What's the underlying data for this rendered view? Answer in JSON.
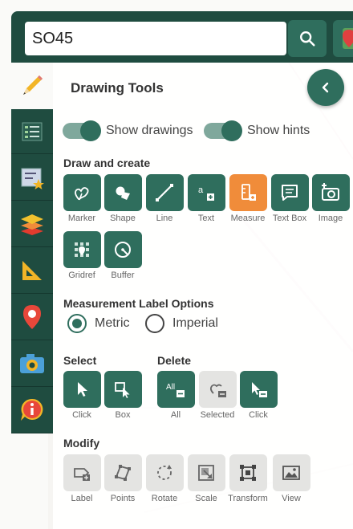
{
  "search": {
    "value": "SO45"
  },
  "icons": {
    "search": "search-icon",
    "map": "map-pin-icon",
    "pencil": "pencil-icon",
    "legend": "legend-list-icon",
    "bookmark": "star-bookmark-icon",
    "layers": "layers-icon",
    "ruler": "set-square-icon",
    "location": "location-pin-icon",
    "camera": "camera-icon",
    "info": "info-icon",
    "collapse": "chevron-left-icon"
  },
  "panel": {
    "title": "Drawing Tools",
    "toggles": [
      {
        "label": "Show drawings",
        "on": true
      },
      {
        "label": "Show hints",
        "on": true
      }
    ],
    "draw_section": "Draw and create",
    "draw_tools": [
      "Marker",
      "Shape",
      "Line",
      "Text",
      "Measure",
      "Text Box",
      "Image"
    ],
    "draw_tools_row2": [
      "Gridref",
      "Buffer"
    ],
    "measure_section": "Measurement Label Options",
    "measure_options": [
      {
        "label": "Metric",
        "selected": true
      },
      {
        "label": "Imperial",
        "selected": false
      }
    ],
    "select_section": "Select",
    "select_tools": [
      "Click",
      "Box"
    ],
    "delete_section": "Delete",
    "delete_tools": [
      "All",
      "Selected",
      "Click"
    ],
    "modify_section": "Modify",
    "modify_tools": [
      "Label",
      "Points",
      "Rotate",
      "Scale",
      "Transform",
      "View"
    ]
  },
  "colors": {
    "primary": "#2f6e5d",
    "dark": "#1f4c40",
    "accent": "#f08c3a",
    "disabled": "#e4e4e2"
  }
}
